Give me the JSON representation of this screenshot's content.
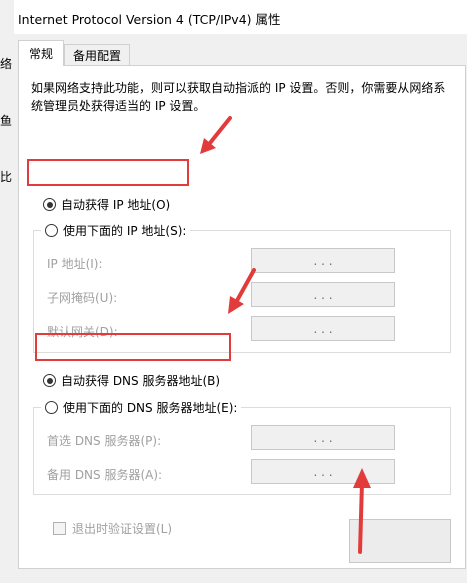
{
  "window": {
    "title": "Internet Protocol Version 4 (TCP/IPv4) 属性"
  },
  "background_chars": [
    "络",
    "鱼",
    "比"
  ],
  "tabs": [
    {
      "label": "常规"
    },
    {
      "label": "备用配置"
    }
  ],
  "general": {
    "description": "如果网络支持此功能，则可以获取自动指派的 IP 设置。否则，你需要从网络系统管理员处获得适当的 IP 设置。",
    "ip": {
      "auto_label": "自动获得 IP 地址(O)",
      "manual_label": "使用下面的 IP 地址(S):",
      "mode": "auto",
      "fields": [
        {
          "label": "IP 地址(I):",
          "value": ". . ."
        },
        {
          "label": "子网掩码(U):",
          "value": ". . ."
        },
        {
          "label": "默认网关(D):",
          "value": ". . ."
        }
      ]
    },
    "dns": {
      "auto_label": "自动获得 DNS 服务器地址(B)",
      "manual_label": "使用下面的 DNS 服务器地址(E):",
      "mode": "auto",
      "fields": [
        {
          "label": "首选 DNS 服务器(P):",
          "value": ". . ."
        },
        {
          "label": "备用 DNS 服务器(A):",
          "value": ". . ."
        }
      ]
    },
    "validate_label": "退出时验证设置(L)"
  },
  "annotation_color": "#e23b3b"
}
